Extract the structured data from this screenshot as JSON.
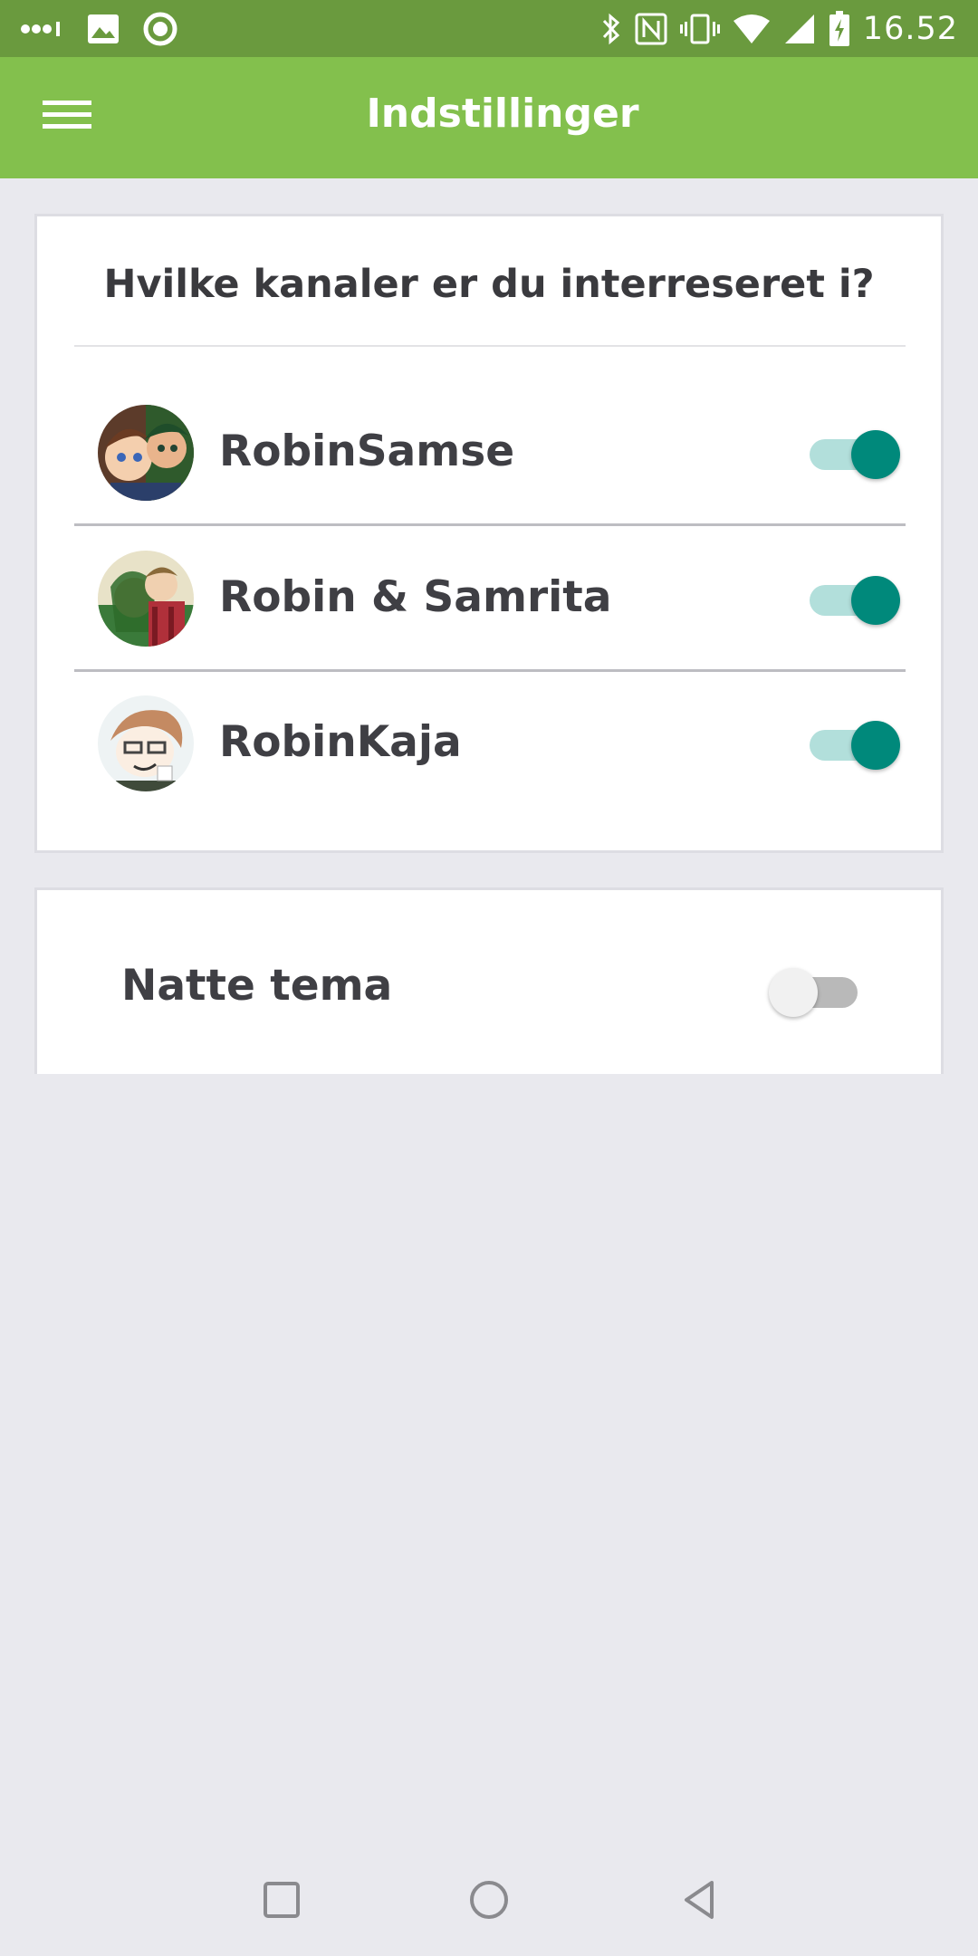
{
  "status_bar": {
    "time": "16.52",
    "icons": [
      "signal-dots-icon",
      "gallery-icon",
      "record-circle-icon",
      "bluetooth-icon",
      "nfc-icon",
      "vibrate-icon",
      "wifi-icon",
      "cell-signal-icon",
      "battery-charging-icon"
    ]
  },
  "app_bar": {
    "title": "Indstillinger",
    "menu_icon": "hamburger-menu-icon"
  },
  "channels_card": {
    "question": "Hvilke kanaler er du interreseret i?",
    "channels": [
      {
        "label": "RobinSamse",
        "enabled": true
      },
      {
        "label": "Robin & Samrita",
        "enabled": true
      },
      {
        "label": "RobinKaja",
        "enabled": true
      }
    ]
  },
  "night_card": {
    "label": "Natte tema",
    "enabled": false
  },
  "nav_bar": {
    "buttons": [
      "recents-square-icon",
      "home-circle-icon",
      "back-triangle-icon"
    ]
  },
  "colors": {
    "status_bar": "#6a9a3e",
    "app_bar": "#83c04d",
    "toggle_on_thumb": "#00897b",
    "toggle_on_track": "#b2dfdb",
    "background": "#e9e9ee"
  }
}
